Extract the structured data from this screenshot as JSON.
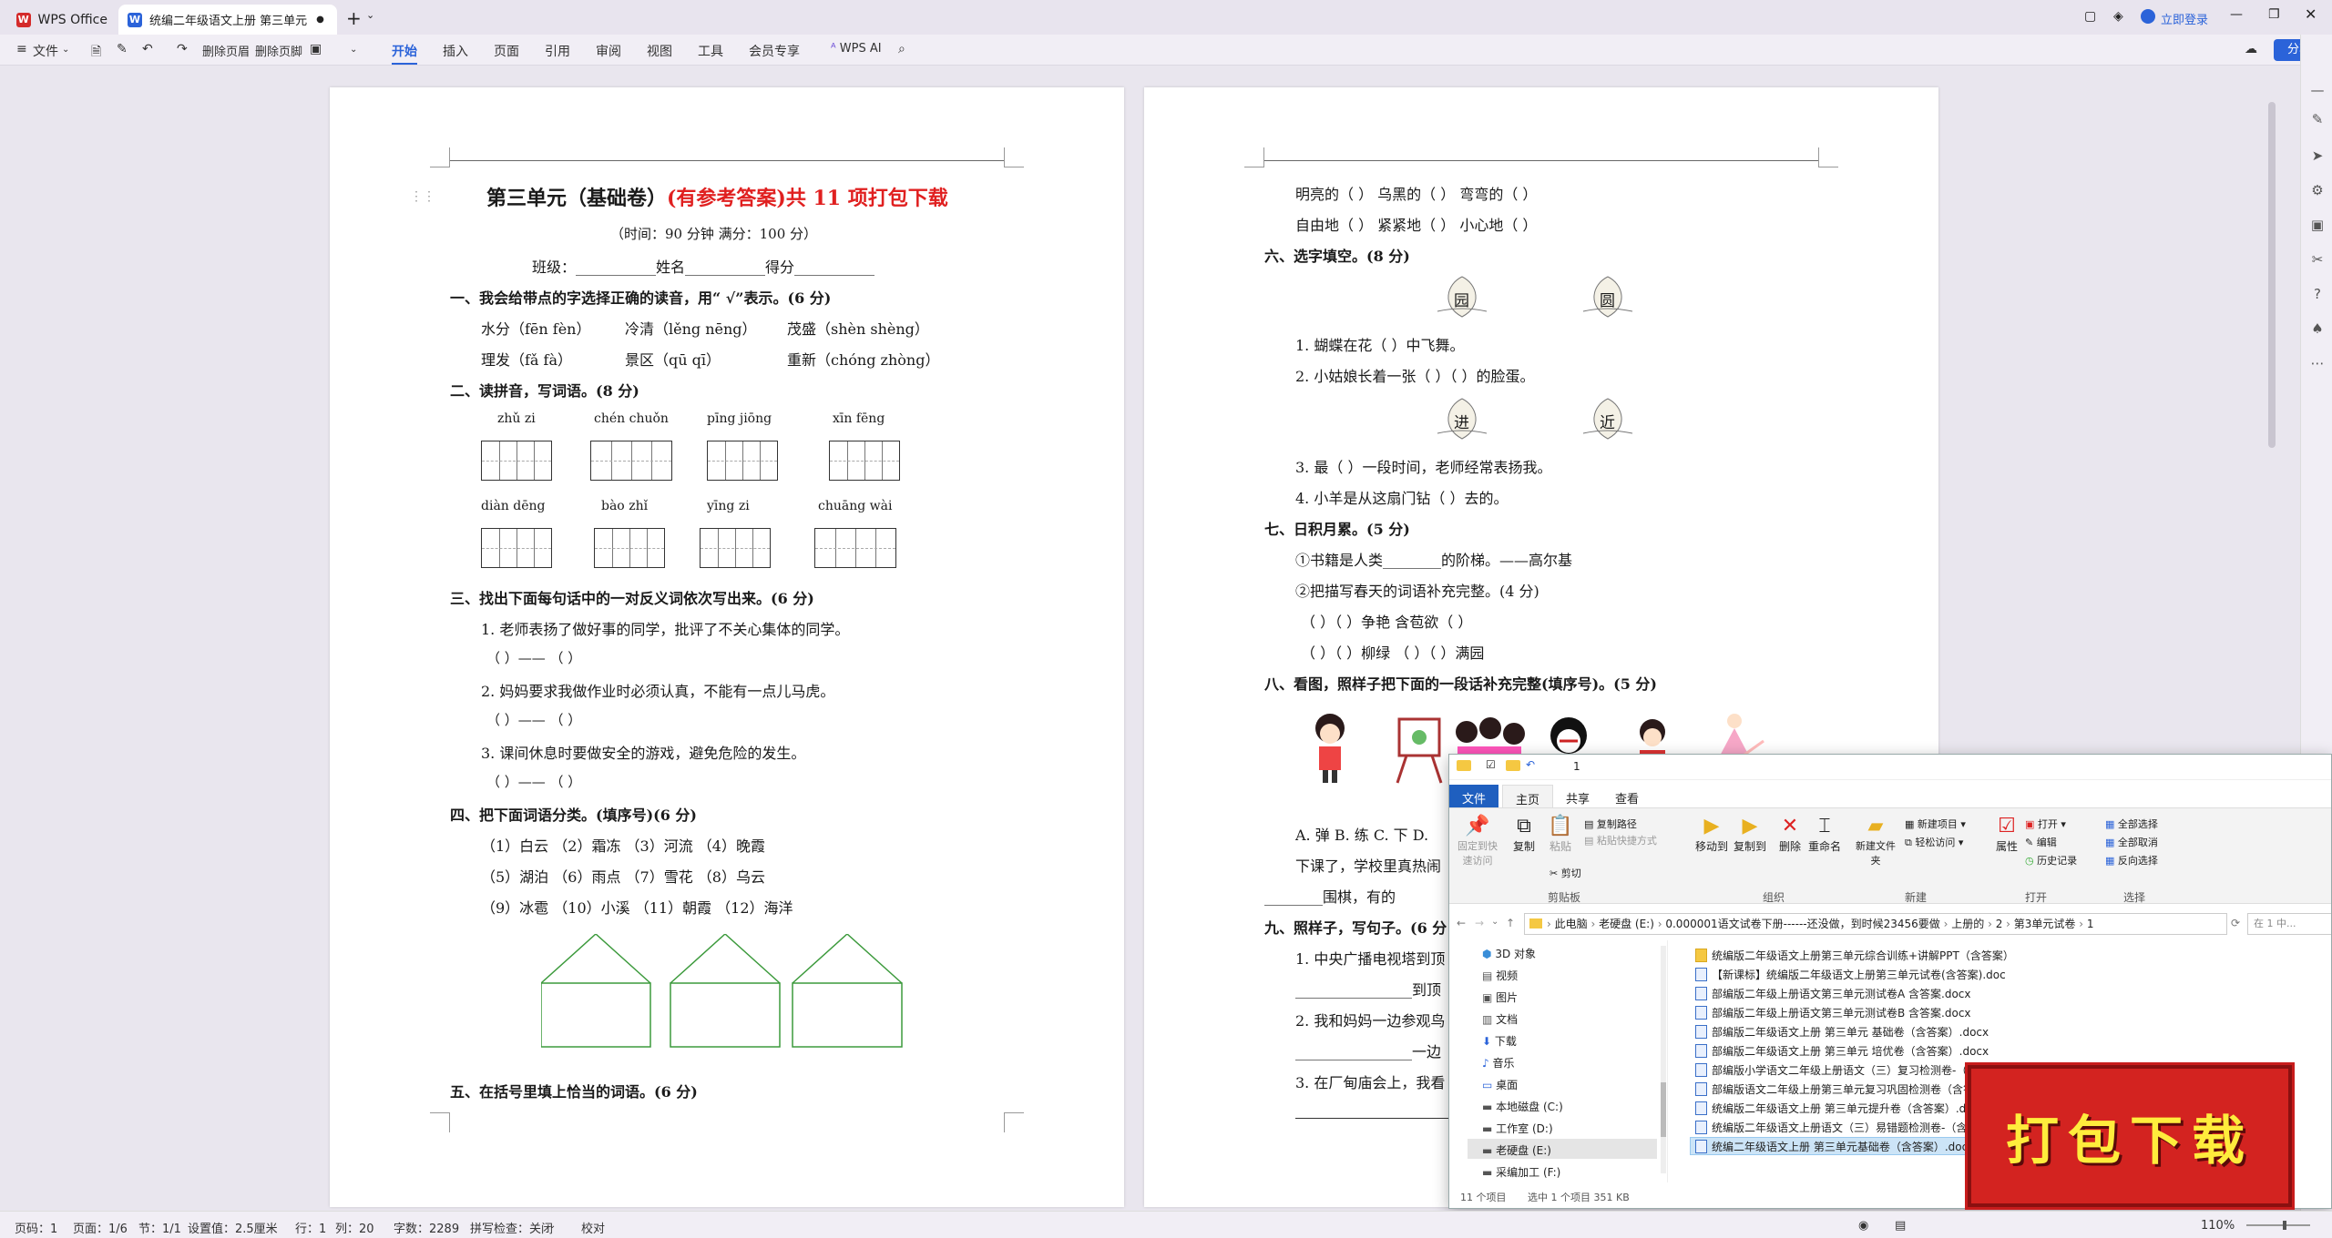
{
  "titlebar": {
    "tabs": [
      {
        "label": "WPS Office"
      },
      {
        "label": "统编二年级语文上册 第三单元"
      }
    ],
    "add_tab": "+",
    "login": "立即登录"
  },
  "ribbon": {
    "file": "文件",
    "delete_header": "删除页眉",
    "delete_footer": "删除页脚",
    "tabs": [
      "开始",
      "插入",
      "页面",
      "引用",
      "审阅",
      "视图",
      "工具",
      "会员专享"
    ],
    "ai": "WPS AI",
    "share": "分享"
  },
  "page1": {
    "title_a": "第三单元（基础卷）",
    "title_b": "(有参考答案)共 11 项打包下载",
    "meta": "（时间：90 分钟   满分：100 分）",
    "info": "班级：___________姓名___________得分___________",
    "q1": "一、我会给带点的字选择正确的读音，用“ √”表示。(6 分)",
    "q1_l1": [
      "水分（fēn  fèn）",
      "冷清（lěng  nēng）",
      "茂盛（shèn  shèng）"
    ],
    "q1_l2": [
      "理发（fǎ  fà）",
      "景区（qū  qī）",
      "重新（chóng  zhòng）"
    ],
    "q2": "二、读拼音，写词语。(8 分)",
    "pinyin_row1": [
      "zhǔ  zi",
      "chén  chuǒn",
      "pīng  jiōng",
      "xīn  fēng"
    ],
    "pinyin_row2": [
      "diàn  dēng",
      "bào  zhǐ",
      "yīng  zi",
      "chuāng  wài"
    ],
    "q3": "三、找出下面每句话中的一对反义词依次写出来。(6 分)",
    "q3_1": "1. 老师表扬了做好事的同学，批评了不关心集体的同学。",
    "q3_2": "2. 妈妈要求我做作业时必须认真，不能有一点儿马虎。",
    "q3_3": "3. 课间休息时要做安全的游戏，避免危险的发生。",
    "blank_pair": "（      ）——  （      ）",
    "q4": "四、把下面词语分类。(填序号)(6 分)",
    "q4_l1": "（1）白云    （2）霜冻    （3）河流    （4）晚霞",
    "q4_l2": "（5）湖泊    （6）雨点    （7）雪花    （8）乌云",
    "q4_l3": "（9）冰雹    （10）小溪    （11）朝霞    （12）海洋",
    "q5": "五、在括号里填上恰当的词语。(6 分)"
  },
  "page2": {
    "l1": "明亮的（      ）     乌黑的（      ）     弯弯的（      ）",
    "l2": "自由地（      ）     紧紧地（      ）     小心地（      ）",
    "q6": "六、选字填空。(8 分)",
    "chars1": [
      "园",
      "圆"
    ],
    "q6_1": "1. 蝴蝶在花（      ）中飞舞。",
    "q6_2": "2. 小姑娘长着一张（      ）（      ）的脸蛋。",
    "chars2": [
      "进",
      "近"
    ],
    "q6_3": "3. 最（      ）一段时间，老师经常表扬我。",
    "q6_4": "4. 小羊是从这扇门钻（      ）去的。",
    "q7": "七、日积月累。(5 分)",
    "q7_1": "①书籍是人类________的阶梯。——高尔基",
    "q7_2": "②把描写春天的词语补充完整。(4 分)",
    "q7_3": "（      ）（      ）争艳   含苞欲（      ）",
    "q7_4": "（      ）（      ）柳绿    （      ）（      ）满园",
    "q8": "八、看图，照样子把下面的一段话补充完整(填序号)。(5 分)",
    "q8_opts": "A. 弹   B. 练   C. 下   D.",
    "q8_t1": "下课了，学校里真热闹",
    "q8_t2": "________围棋，有的",
    "q9": "九、照样子，写句子。(6 分",
    "q9_1": "1. 中央广播电视塔到顶",
    "q9_1b": "________________到顶",
    "q9_2": "2. 我和妈妈一边参观鸟",
    "q9_2b": "________________一边",
    "q9_3": "3. 在厂甸庙会上，我看"
  },
  "explorer": {
    "title": "1",
    "tabs": [
      "文件",
      "主页",
      "共享",
      "查看"
    ],
    "buttons": [
      "固定到快速访问",
      "复制",
      "粘贴",
      "复制路径",
      "粘贴快捷方式",
      "剪切",
      "移动到",
      "复制到",
      "删除",
      "重命名",
      "新建文件夹",
      "新建项目",
      "轻松访问",
      "属性",
      "打开",
      "编辑",
      "历史记录",
      "全部选择",
      "全部取消",
      "反向选择"
    ],
    "groups": [
      "剪贴板",
      "组织",
      "新建",
      "打开",
      "选择"
    ],
    "path": [
      "此电脑",
      "老硬盘 (E:)",
      "0.000001语文试卷下册------还没做，到时候23456要做",
      "上册的",
      "2",
      "第3单元试卷",
      "1"
    ],
    "search_placeholder": "在 1 中...",
    "nav": [
      "3D 对象",
      "视频",
      "图片",
      "文档",
      "下载",
      "音乐",
      "桌面",
      "本地磁盘 (C:)",
      "工作室 (D:)",
      "老硬盘 (E:)",
      "采编加工 (F:)"
    ],
    "files": [
      "统编版二年级语文上册第三单元综合训练+讲解PPT（含答案）",
      "【新课标】统编版二年级语文上册第三单元试卷(含答案).doc",
      "部编版二年级上册语文第三单元测试卷A   含答案.docx",
      "部编版二年级上册语文第三单元测试卷B   含答案.docx",
      "部编版二年级语文上册 第三单元 基础卷（含答案）.docx",
      "部编版二年级语文上册 第三单元 培优卷（含答案）.docx",
      "部编版小学语文二年级上册语文（三）复习检测卷-（含答案）.docx",
      "部编版语文二年级上册第三单元复习巩固检测卷（含答案）",
      "统编版二年级语文上册 第三单元提升卷（含答案）.docx",
      "统编版二年级语文上册语文（三）易错题检测卷-（含答案）",
      "统编二年级语文上册 第三单元基础卷（含答案）.docx"
    ],
    "status": [
      "11 个项目",
      "选中 1 个项目  351 KB"
    ]
  },
  "stamp": "打包下载",
  "statusbar": {
    "items": [
      "页码：1",
      "页面：1/6",
      "节：1/1",
      "设置值：2.5厘米",
      "行：1",
      "列：20",
      "字数：2289",
      "拼写检查：关闭",
      "校对"
    ],
    "zoom": "110%"
  }
}
